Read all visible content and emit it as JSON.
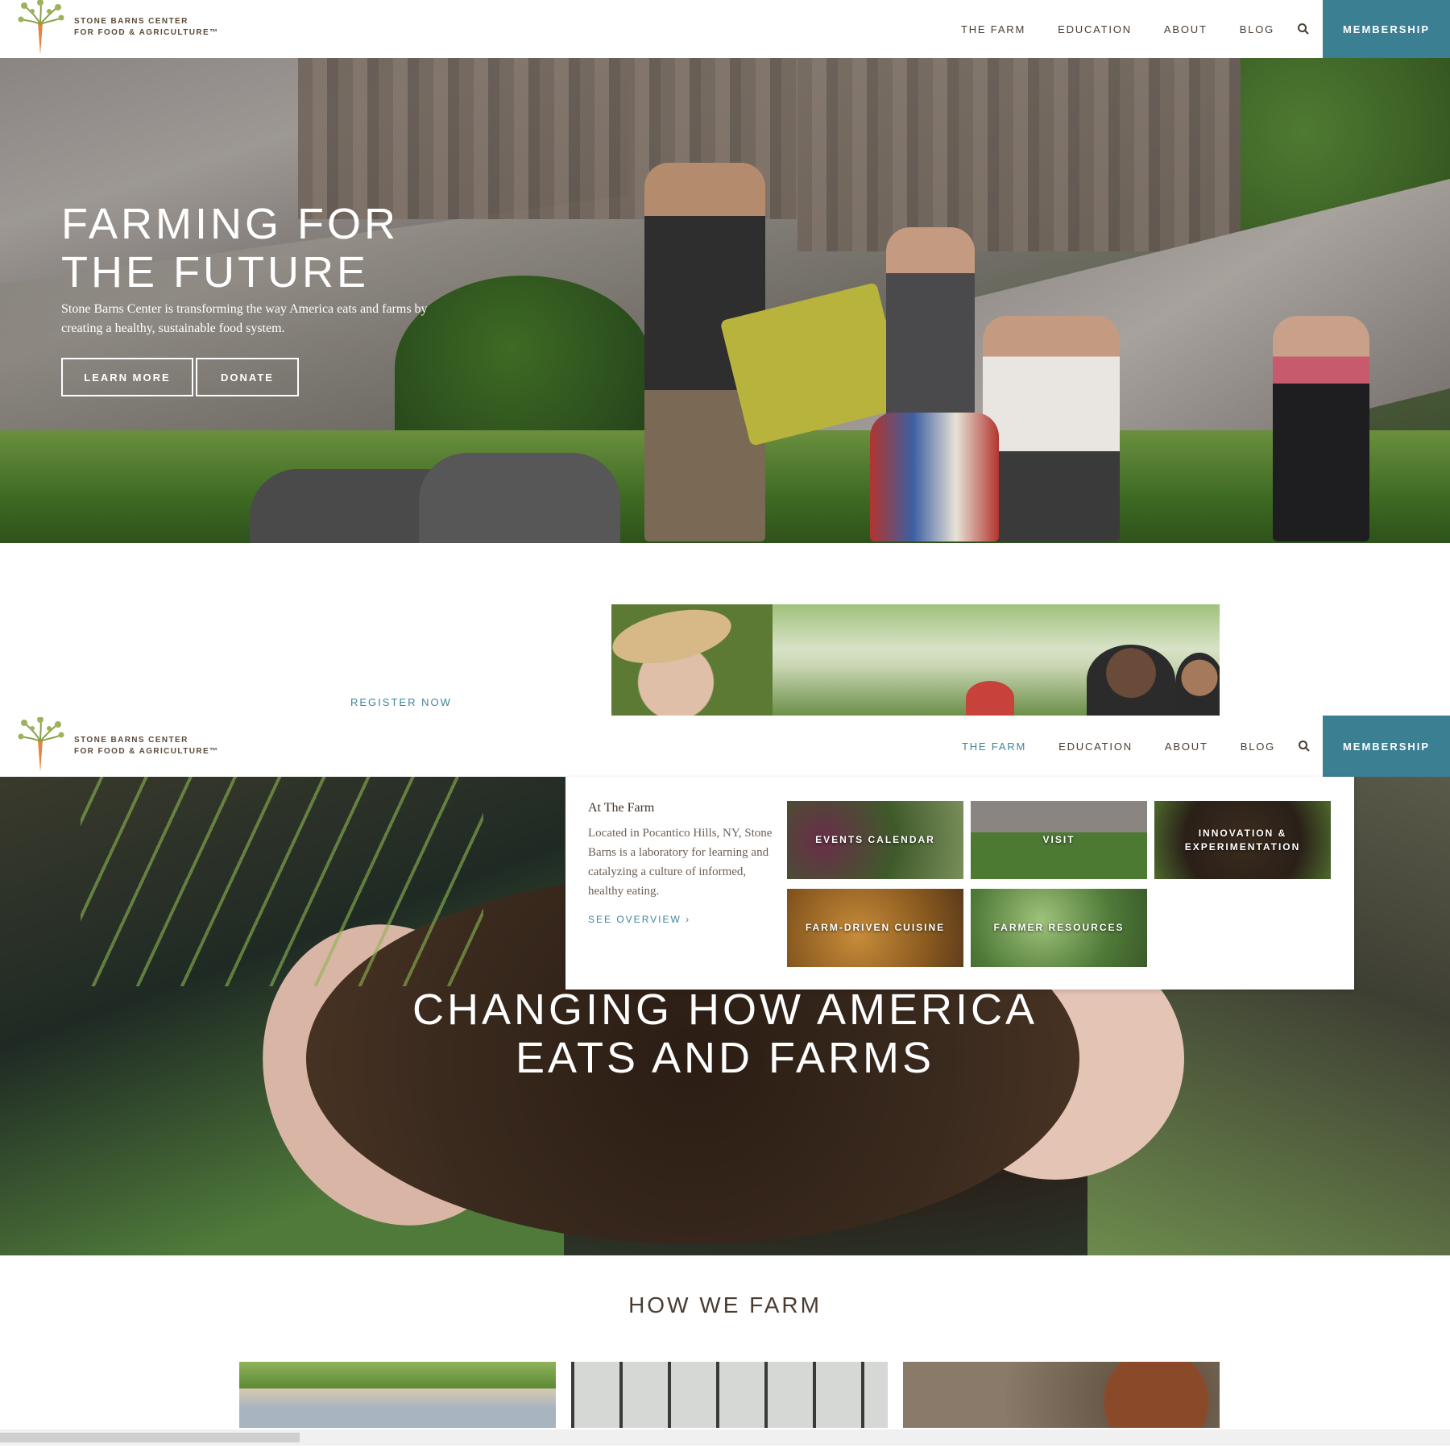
{
  "brand": {
    "line1": "STONE BARNS CENTER",
    "line2": "FOR FOOD & AGRICULTURE™"
  },
  "nav": {
    "items": [
      "THE FARM",
      "EDUCATION",
      "ABOUT",
      "BLOG"
    ],
    "membership": "MEMBERSHIP",
    "active_in_second_header": "THE FARM"
  },
  "hero1": {
    "title_line1": "FARMING FOR",
    "title_line2": "THE FUTURE",
    "subtitle": "Stone Barns Center is transforming the way America eats and farms by creating a healthy, sustainable food system.",
    "learn_more": "LEARN MORE",
    "donate": "DONATE"
  },
  "mid": {
    "register": "REGISTER NOW"
  },
  "dropdown": {
    "heading": "At The Farm",
    "description": "Located in Pocantico Hills, NY, Stone Barns is a laboratory for learning and catalyzing a culture of informed, healthy eating.",
    "overview_link": "SEE OVERVIEW  ›",
    "tiles": [
      "EVENTS CALENDAR",
      "VISIT",
      "INNOVATION & EXPERIMENTATION",
      "FARM-DRIVEN CUISINE",
      "FARMER RESOURCES"
    ]
  },
  "hero2": {
    "title_line1": "CHANGING HOW AMERICA",
    "title_line2": "EATS AND FARMS"
  },
  "how": {
    "title": "HOW WE FARM"
  },
  "colors": {
    "accent": "#3b7f93",
    "text_brown": "#4a3c30"
  }
}
